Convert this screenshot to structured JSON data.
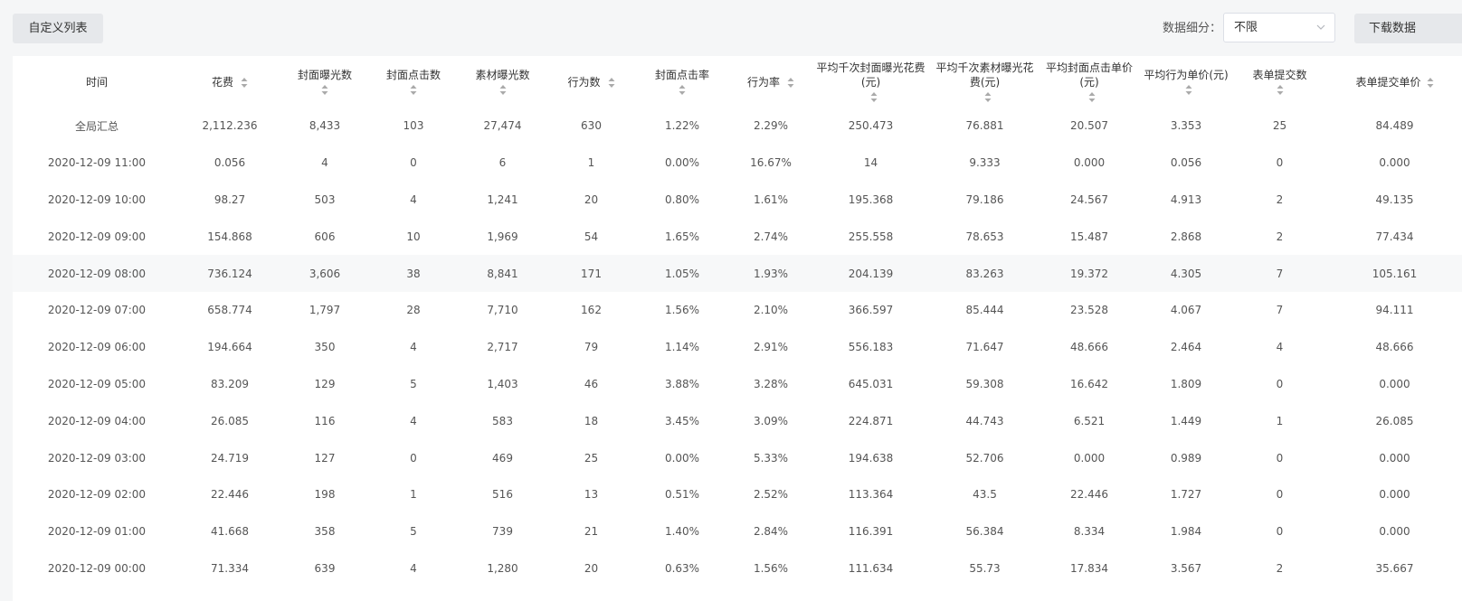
{
  "toolbar": {
    "custom_list_label": "自定义列表",
    "breakdown_label": "数据细分：",
    "breakdown_value": "不限",
    "download_label": "下载数据"
  },
  "table": {
    "columns": [
      {
        "id": "time",
        "label": "时间",
        "sortable": false
      },
      {
        "id": "cost",
        "label": "花费",
        "sortable": true
      },
      {
        "id": "cover_impr",
        "label": "封面曝光数",
        "sortable": true
      },
      {
        "id": "cover_click",
        "label": "封面点击数",
        "sortable": true
      },
      {
        "id": "material_impr",
        "label": "素材曝光数",
        "sortable": true
      },
      {
        "id": "actions",
        "label": "行为数",
        "sortable": true
      },
      {
        "id": "cover_ctr",
        "label": "封面点击率",
        "sortable": true
      },
      {
        "id": "action_rate",
        "label": "行为率",
        "sortable": true
      },
      {
        "id": "cpm_cover",
        "label": "平均千次封面曝光花费(元)",
        "sortable": true
      },
      {
        "id": "cpm_material",
        "label": "平均千次素材曝光花费(元)",
        "sortable": true
      },
      {
        "id": "cpc_cover",
        "label": "平均封面点击单价(元)",
        "sortable": true
      },
      {
        "id": "cpa",
        "label": "平均行为单价(元)",
        "sortable": true
      },
      {
        "id": "forms",
        "label": "表单提交数",
        "sortable": true
      },
      {
        "id": "cost_per_form",
        "label": "表单提交单价",
        "sortable": true
      }
    ],
    "rows": [
      [
        "全局汇总",
        "2,112.236",
        "8,433",
        "103",
        "27,474",
        "630",
        "1.22%",
        "2.29%",
        "250.473",
        "76.881",
        "20.507",
        "3.353",
        "25",
        "84.489"
      ],
      [
        "2020-12-09 11:00",
        "0.056",
        "4",
        "0",
        "6",
        "1",
        "0.00%",
        "16.67%",
        "14",
        "9.333",
        "0.000",
        "0.056",
        "0",
        "0.000"
      ],
      [
        "2020-12-09 10:00",
        "98.27",
        "503",
        "4",
        "1,241",
        "20",
        "0.80%",
        "1.61%",
        "195.368",
        "79.186",
        "24.567",
        "4.913",
        "2",
        "49.135"
      ],
      [
        "2020-12-09 09:00",
        "154.868",
        "606",
        "10",
        "1,969",
        "54",
        "1.65%",
        "2.74%",
        "255.558",
        "78.653",
        "15.487",
        "2.868",
        "2",
        "77.434"
      ],
      [
        "2020-12-09 08:00",
        "736.124",
        "3,606",
        "38",
        "8,841",
        "171",
        "1.05%",
        "1.93%",
        "204.139",
        "83.263",
        "19.372",
        "4.305",
        "7",
        "105.161"
      ],
      [
        "2020-12-09 07:00",
        "658.774",
        "1,797",
        "28",
        "7,710",
        "162",
        "1.56%",
        "2.10%",
        "366.597",
        "85.444",
        "23.528",
        "4.067",
        "7",
        "94.111"
      ],
      [
        "2020-12-09 06:00",
        "194.664",
        "350",
        "4",
        "2,717",
        "79",
        "1.14%",
        "2.91%",
        "556.183",
        "71.647",
        "48.666",
        "2.464",
        "4",
        "48.666"
      ],
      [
        "2020-12-09 05:00",
        "83.209",
        "129",
        "5",
        "1,403",
        "46",
        "3.88%",
        "3.28%",
        "645.031",
        "59.308",
        "16.642",
        "1.809",
        "0",
        "0.000"
      ],
      [
        "2020-12-09 04:00",
        "26.085",
        "116",
        "4",
        "583",
        "18",
        "3.45%",
        "3.09%",
        "224.871",
        "44.743",
        "6.521",
        "1.449",
        "1",
        "26.085"
      ],
      [
        "2020-12-09 03:00",
        "24.719",
        "127",
        "0",
        "469",
        "25",
        "0.00%",
        "5.33%",
        "194.638",
        "52.706",
        "0.000",
        "0.989",
        "0",
        "0.000"
      ],
      [
        "2020-12-09 02:00",
        "22.446",
        "198",
        "1",
        "516",
        "13",
        "0.51%",
        "2.52%",
        "113.364",
        "43.5",
        "22.446",
        "1.727",
        "0",
        "0.000"
      ],
      [
        "2020-12-09 01:00",
        "41.668",
        "358",
        "5",
        "739",
        "21",
        "1.40%",
        "2.84%",
        "116.391",
        "56.384",
        "8.334",
        "1.984",
        "0",
        "0.000"
      ],
      [
        "2020-12-09 00:00",
        "71.334",
        "639",
        "4",
        "1,280",
        "20",
        "0.63%",
        "1.56%",
        "111.634",
        "55.73",
        "17.834",
        "3.567",
        "2",
        "35.667"
      ]
    ]
  },
  "colors": {
    "page_bg": "#f5f6f7",
    "button_bg": "#e6e8eb",
    "table_bg": "#ffffff",
    "highlight_row_bg": "#f7f8f9",
    "sort_icon": "#aaaaaa"
  },
  "icons": {
    "sort": "sort-icon",
    "dropdown": "chevron-down-icon"
  }
}
